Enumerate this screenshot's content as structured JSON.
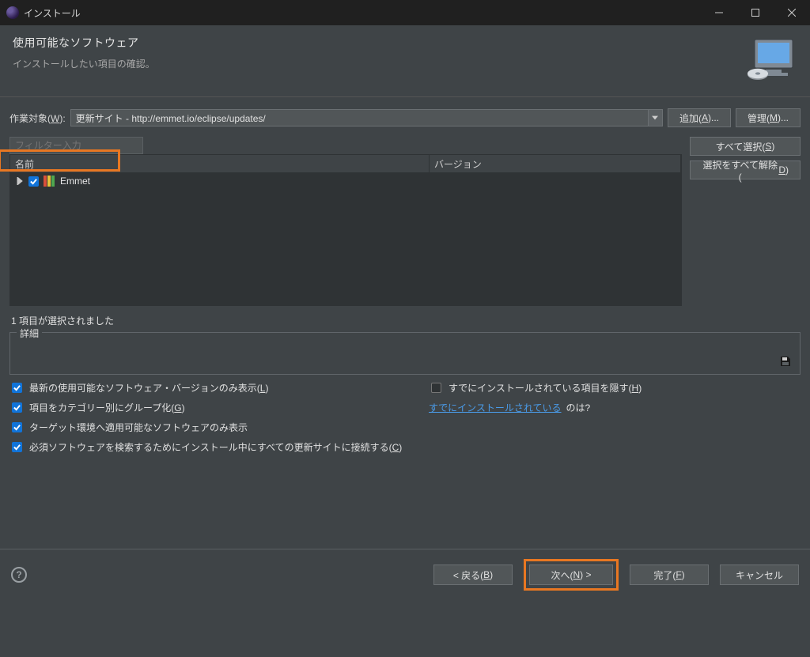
{
  "titlebar": {
    "title": "インストール"
  },
  "header": {
    "heading": "使用可能なソフトウェア",
    "subtext": "インストールしたい項目の確認。"
  },
  "workRow": {
    "label_pre": "作業対象(",
    "label_u": "W",
    "label_post": "):",
    "combo_value": "更新サイト - http://emmet.io/eclipse/updates/",
    "add_btn_pre": "追加(",
    "add_btn_u": "A",
    "add_btn_post": ")...",
    "manage_btn_pre": "管理(",
    "manage_btn_u": "M",
    "manage_btn_post": ")..."
  },
  "filter": {
    "placeholder": "フィルター入力"
  },
  "sideButtons": {
    "selectAll_pre": "すべて選択(",
    "selectAll_u": "S",
    "selectAll_post": ")",
    "deselectAll_pre": "選択をすべて解除(",
    "deselectAll_u": "D",
    "deselectAll_post": ")"
  },
  "table": {
    "col_name": "名前",
    "col_version": "バージョン",
    "rows": [
      {
        "label": "Emmet",
        "checked": true
      }
    ]
  },
  "statusLine": "1 項目が選択されました",
  "detailsFieldset": {
    "legend": "詳細"
  },
  "checks": {
    "c1_pre": "最新の使用可能なソフトウェア・バージョンのみ表示(",
    "c1_u": "L",
    "c1_post": ")",
    "c2_pre": "すでにインストールされている項目を隠す(",
    "c2_u": "H",
    "c2_post": ")",
    "c3_pre": "項目をカテゴリー別にグループ化(",
    "c3_u": "G",
    "c3_post": ")",
    "c4_link": "すでにインストールされている",
    "c4_suffix": " のは?",
    "c5": "ターゲット環境へ適用可能なソフトウェアのみ表示",
    "c6_pre": "必須ソフトウェアを検索するためにインストール中にすべての更新サイトに接続する(",
    "c6_u": "C",
    "c6_post": ")"
  },
  "footer": {
    "back_pre": "< 戻る(",
    "back_u": "B",
    "back_post": ")",
    "next_pre": "次へ(",
    "next_u": "N",
    "next_post": ") >",
    "finish_pre": "完了(",
    "finish_u": "F",
    "finish_post": ")",
    "cancel": "キャンセル"
  }
}
